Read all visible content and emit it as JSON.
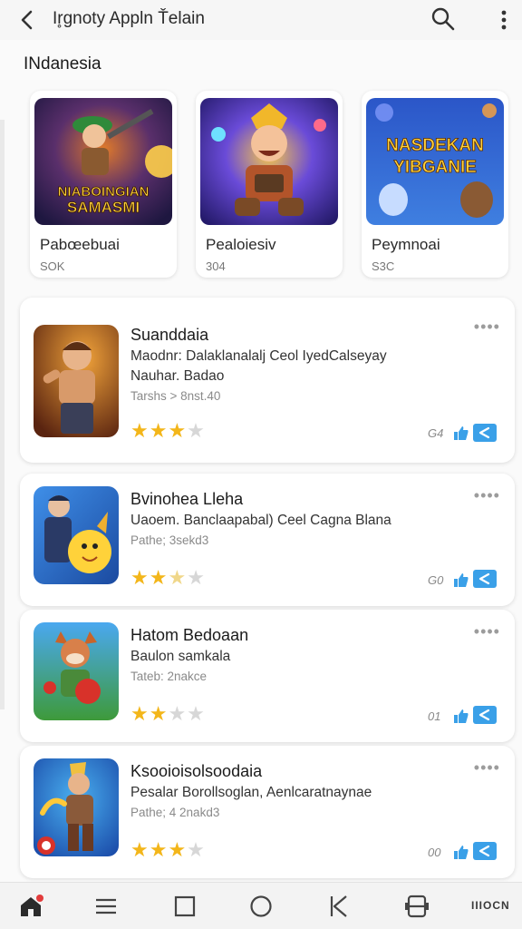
{
  "header": {
    "title": "Ir̥gnoty Appln Ťelain"
  },
  "section": {
    "title": "INdanesia"
  },
  "featured": [
    {
      "name": "Pabœebuai",
      "stat": "SOK",
      "art_text": [
        "NIABOINGIAN",
        "SAMASMI"
      ]
    },
    {
      "name": "Pealoiesiv",
      "stat": "304"
    },
    {
      "name": "Peymnoai",
      "stat": "S3C",
      "art_text": [
        "NASDEKAN",
        "YIBGANIE"
      ]
    }
  ],
  "apps": [
    {
      "title": "Suanddaia",
      "line1": "Maodnr: Dalaklanalalj Ceol IyedCalseyay",
      "line2": "Nauhar. Badao",
      "line3": "Tarshs > 8nst.40",
      "rating": 3,
      "count": "G4"
    },
    {
      "title": "Bvinohea Lleha",
      "line1": "Uaoem. Banclaapabal) Ceel Cagna Blana",
      "line2": "",
      "line3": "Pathe; 3sekd3",
      "rating": 2.5,
      "count": "G0"
    },
    {
      "title": "Hatom Bedoaan",
      "line1": "Baulon samkala",
      "line2": "",
      "line3": "Tateb: 2nakce",
      "rating": 2,
      "count": "01"
    },
    {
      "title": "Ksooioisolsoodaia",
      "line1": "Pesalar Borollsoglan, Aenlcaratnaynae",
      "line2": "",
      "line3": "Pathe; 4 2nakd3",
      "rating": 3,
      "count": "00"
    }
  ],
  "bottom_nav": {
    "label": "IIIOCN"
  },
  "colors": {
    "star": "#f3b61a",
    "accent": "#3aa0e8",
    "notify": "#e23b3b"
  }
}
